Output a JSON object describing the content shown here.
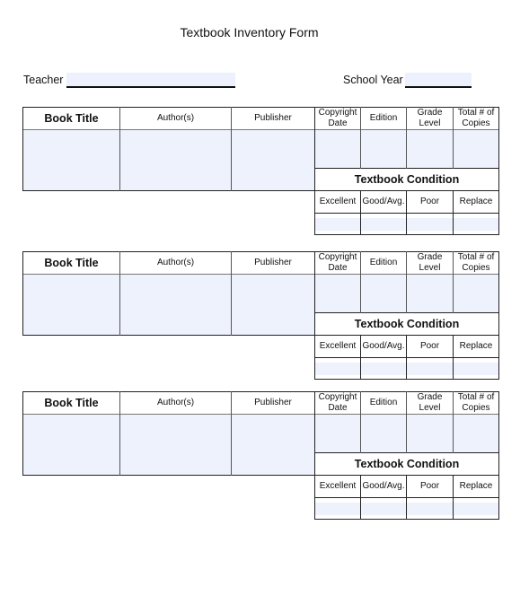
{
  "title": "Textbook  Inventory Form",
  "fields": {
    "teacher_label": "Teacher",
    "teacher_value": "",
    "school_year_label": "School Year",
    "school_year_value": ""
  },
  "colors": {
    "fill": "#eef2fd",
    "border": "#222222"
  },
  "sections": [
    {
      "headers": {
        "book_title": "Book Title",
        "authors": "Author(s)",
        "publisher": "Publisher",
        "copyright_date": "Copyright Date",
        "edition": "Edition",
        "grade_level": "Grade Level",
        "total_copies": "Total # of Copies"
      },
      "condition_title": "Textbook Condition",
      "condition_labels": [
        "Excellent",
        "Good/Avg.",
        "Poor",
        "Replace"
      ]
    },
    {
      "headers": {
        "book_title": "Book Title",
        "authors": "Author(s)",
        "publisher": "Publisher",
        "copyright_date": "Copyright Date",
        "edition": "Edition",
        "grade_level": "Grade Level",
        "total_copies": "Total # of Copies"
      },
      "condition_title": "Textbook Condition",
      "condition_labels": [
        "Excellent",
        "Good/Avg.",
        "Poor",
        "Replace"
      ]
    },
    {
      "headers": {
        "book_title": "Book Title",
        "authors": "Author(s)",
        "publisher": "Publisher",
        "copyright_date": "Copyright Date",
        "edition": "Edition",
        "grade_level": "Grade Level",
        "total_copies": "Total # of Copies"
      },
      "condition_title": "Textbook Condition",
      "condition_labels": [
        "Excellent",
        "Good/Avg.",
        "Poor",
        "Replace"
      ]
    }
  ]
}
